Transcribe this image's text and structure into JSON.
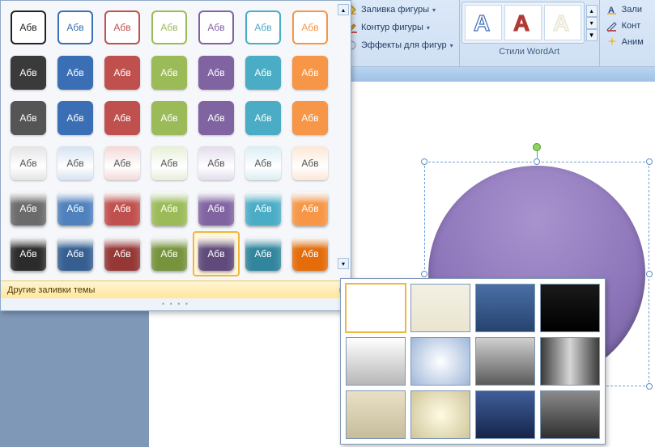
{
  "ribbon": {
    "shape_fill": "Заливка фигуры",
    "shape_outline": "Контур фигуры",
    "shape_effects": "Эффекты для фигур",
    "wordart_group_label": "Стили WordArt",
    "wordart_glyph": "A",
    "text_fill": "Зали",
    "text_outline": "Конт",
    "text_anim": "Аним"
  },
  "gallery": {
    "swatch_text": "Абв",
    "more_fills": "Другие заливки темы",
    "selected_index": 39,
    "rows": [
      {
        "type": "outline",
        "text_dark": true,
        "colors": [
          "#222222",
          "#3b6fb5",
          "#c0504d",
          "#9bbb59",
          "#8064a2",
          "#4bacc6",
          "#f79646"
        ]
      },
      {
        "type": "fill",
        "text_dark": false,
        "colors": [
          "#3a3a3a",
          "#3b6fb5",
          "#c0504d",
          "#9bbb59",
          "#8064a2",
          "#4bacc6",
          "#f79646"
        ]
      },
      {
        "type": "fill",
        "text_dark": false,
        "colors": [
          "#555555",
          "#3b6fb5",
          "#c0504d",
          "#9bbb59",
          "#8064a2",
          "#4bacc6",
          "#f79646"
        ]
      },
      {
        "type": "soft",
        "text_dark": true,
        "colors": [
          "#e4e4e4",
          "#d5e2f2",
          "#f3d8d7",
          "#e7efd8",
          "#e3dcec",
          "#daeef3",
          "#fce7d6"
        ]
      },
      {
        "type": "gloss",
        "text_dark": false,
        "colors": [
          "#6b6b6b",
          "#4f81bd",
          "#c0504d",
          "#9bbb59",
          "#8064a2",
          "#4bacc6",
          "#f79646"
        ]
      },
      {
        "type": "gloss",
        "text_dark": false,
        "colors": [
          "#2b2b2b",
          "#365f91",
          "#953735",
          "#77933c",
          "#604a7b",
          "#31859c",
          "#e46c0a"
        ]
      }
    ]
  },
  "fills": {
    "selected_index": 0,
    "items": [
      "linear-gradient(#ffffff,#ffffff)",
      "linear-gradient(#f3f0e3,#eae5d0)",
      "linear-gradient(#4a6fa5,#26436f)",
      "linear-gradient(#1a1a1a,#000000)",
      "linear-gradient(#ffffff,#b7b7b7)",
      "radial-gradient(circle at 50% 50%,#ffffff,#9fb7da)",
      "linear-gradient(#d0d0d0,#5a5a5a)",
      "linear-gradient(90deg,#3a3a3a,#d6d6d6,#3a3a3a)",
      "linear-gradient(#e9e0c6,#c7bd9c)",
      "radial-gradient(circle at 50% 50%,#fffbe3,#d0c69a)",
      "linear-gradient(#3f5e9a,#16254a)",
      "linear-gradient(#8a8a8a,#2f2f2f)"
    ]
  },
  "wordart_swatches": [
    {
      "stroke": "#3e6db5",
      "fill": "none"
    },
    {
      "stroke": "#b23a34",
      "fill": "#b23a34"
    },
    {
      "stroke": "#e8e3d0",
      "fill": "#f8f6ee"
    }
  ]
}
